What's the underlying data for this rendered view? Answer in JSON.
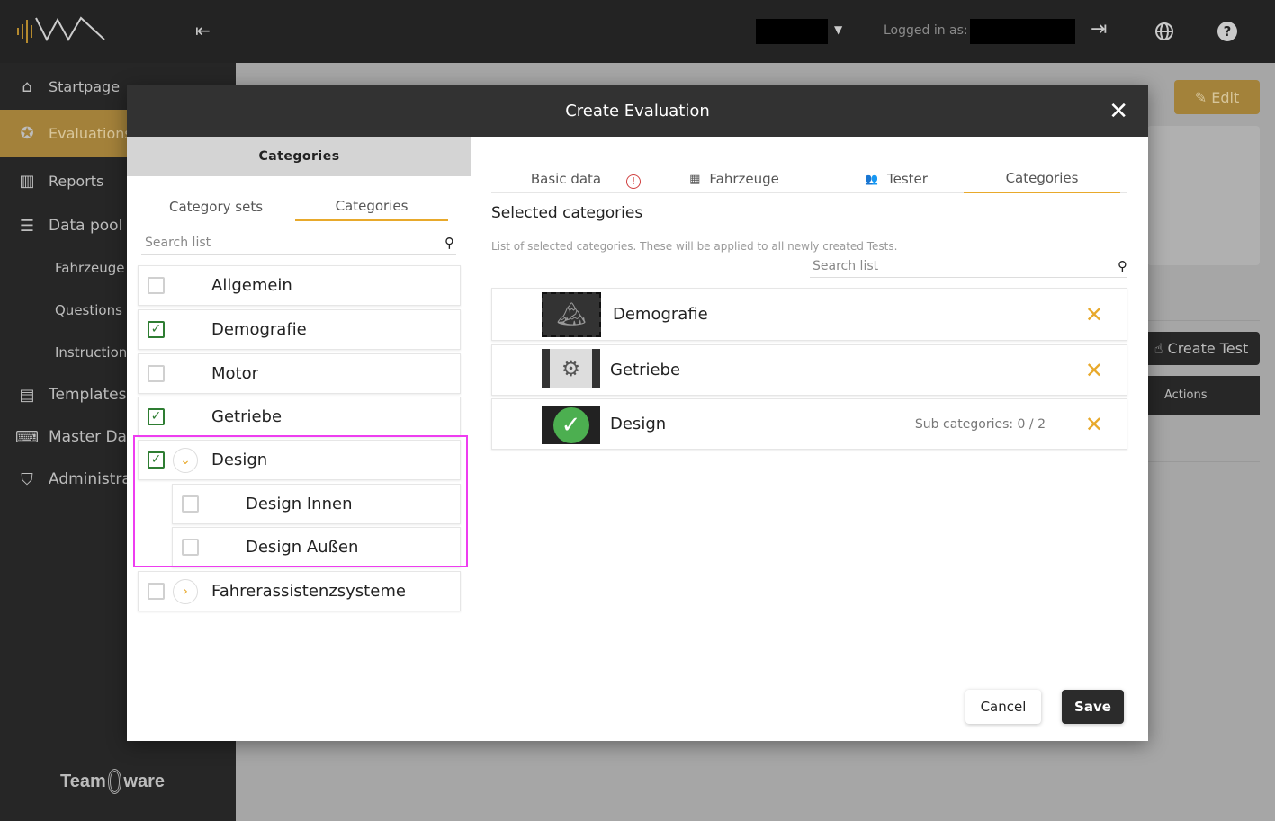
{
  "topbar": {
    "logged_in_label": "Logged in as:",
    "icons": [
      "logout-icon",
      "globe-icon",
      "help-icon"
    ]
  },
  "sidebar": {
    "items": [
      {
        "label": "Startpage",
        "icon": "home-icon"
      },
      {
        "label": "Evaluations",
        "icon": "star-icon",
        "active": true
      },
      {
        "label": "Reports",
        "icon": "bar-chart-icon"
      },
      {
        "label": "Data pool",
        "icon": "list-icon"
      },
      {
        "label": "Fahrzeuge"
      },
      {
        "label": "Questions"
      },
      {
        "label": "Instructions"
      },
      {
        "label": "Templates",
        "icon": "table-icon"
      },
      {
        "label": "Master Dat",
        "icon": "keyboard-icon"
      },
      {
        "label": "Administra",
        "icon": "shield-icon"
      }
    ],
    "footer_logo": "Teamware SOLUTIONS"
  },
  "background": {
    "edit_label": "Edit",
    "create_test_label": "Create Test",
    "actions_label": "Actions"
  },
  "modal": {
    "title": "Create Evaluation",
    "left": {
      "header": "Categories",
      "tabs": [
        "Category sets",
        "Categories"
      ],
      "search_placeholder": "Search list",
      "items": [
        {
          "label": "Allgemein",
          "checked": false
        },
        {
          "label": "Demografie",
          "checked": true
        },
        {
          "label": "Motor",
          "checked": false
        },
        {
          "label": "Getriebe",
          "checked": true
        },
        {
          "label": "Design",
          "checked": true,
          "expanded": true,
          "children": [
            {
              "label": "Design Innen",
              "checked": false
            },
            {
              "label": "Design Außen",
              "checked": false
            }
          ]
        },
        {
          "label": "Fahrerassistenzsysteme",
          "checked": false,
          "expanded": false
        }
      ]
    },
    "right": {
      "tabs": [
        "Basic data",
        "Fahrzeuge",
        "Tester",
        "Categories"
      ],
      "title": "Selected categories",
      "description": "List of selected categories. These will be applied to all newly created Tests.",
      "search_placeholder": "Search list",
      "selected": [
        {
          "label": "Demografie",
          "sub": ""
        },
        {
          "label": "Getriebe",
          "sub": ""
        },
        {
          "label": "Design",
          "sub": "Sub categories: 0 / 2"
        }
      ]
    },
    "cancel_label": "Cancel",
    "save_label": "Save"
  },
  "colors": {
    "accent": "#e8a92b",
    "active_nav": "#a3813a",
    "highlight": "#ee3df0"
  }
}
